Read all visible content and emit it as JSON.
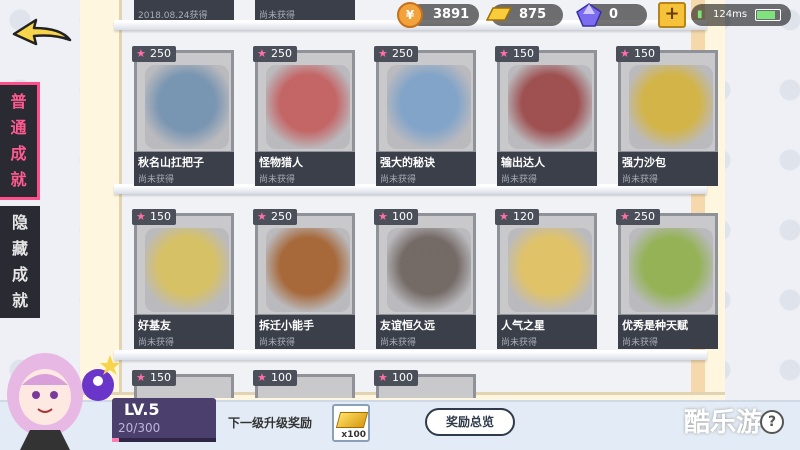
{
  "hud": {
    "coin_value": "3891",
    "gold_value": "875",
    "gem_value": "0",
    "latency": "124ms"
  },
  "tabs": {
    "normal": [
      "普",
      "通",
      "成",
      "就"
    ],
    "hidden": [
      "隐",
      "藏",
      "成",
      "就"
    ]
  },
  "top_row_partial": {
    "left_text": "2018.08.24获得",
    "mid_text": "尚未获得"
  },
  "cards_row1": [
    {
      "points": "250",
      "name": "秋名山扛把子",
      "status": "尚未获得",
      "color": "#6f8fae"
    },
    {
      "points": "250",
      "name": "怪物猎人",
      "status": "尚未获得",
      "color": "#c45a5a"
    },
    {
      "points": "250",
      "name": "强大的秘诀",
      "status": "尚未获得",
      "color": "#7aa0c8"
    },
    {
      "points": "150",
      "name": "输出达人",
      "status": "尚未获得",
      "color": "#9a4343"
    },
    {
      "points": "150",
      "name": "强力沙包",
      "status": "尚未获得",
      "color": "#d4b23a"
    }
  ],
  "cards_row2": [
    {
      "points": "150",
      "name": "好基友",
      "status": "尚未获得",
      "color": "#d8c05a"
    },
    {
      "points": "250",
      "name": "拆迁小能手",
      "status": "尚未获得",
      "color": "#a35e2a"
    },
    {
      "points": "100",
      "name": "友谊恒久远",
      "status": "尚未获得",
      "color": "#6a5f5a"
    },
    {
      "points": "120",
      "name": "人气之星",
      "status": "尚未获得",
      "color": "#e2c25e"
    },
    {
      "points": "250",
      "name": "优秀是种天赋",
      "status": "尚未获得",
      "color": "#8fb04a"
    }
  ],
  "cards_row3": [
    {
      "points": "150"
    },
    {
      "points": "100"
    },
    {
      "points": "100"
    }
  ],
  "player": {
    "level_label": "LV.5",
    "exp_text": "20/300",
    "exp_fraction": 0.067
  },
  "bottom": {
    "next_reward_label": "下一级升级奖励",
    "reward_count": "x100",
    "overview_button": "奖励总览",
    "watermark": "酷乐游",
    "help": "?"
  }
}
